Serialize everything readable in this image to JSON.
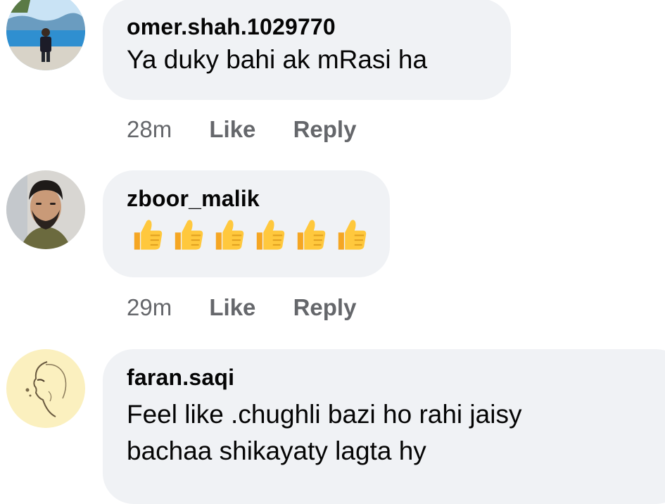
{
  "comments": [
    {
      "author": "omer.shah.1029770",
      "text": "Ya duky bahi ak mRasi ha",
      "time": "28m",
      "like_label": "Like",
      "reply_label": "Reply",
      "avatar": "profile-photo"
    },
    {
      "author": "zboor_malik",
      "text": "",
      "emoji": [
        "thumbs-up-icon",
        "thumbs-up-icon",
        "thumbs-up-icon",
        "thumbs-up-icon",
        "thumbs-up-icon",
        "thumbs-up-icon"
      ],
      "time": "29m",
      "like_label": "Like",
      "reply_label": "Reply",
      "avatar": "profile-photo"
    },
    {
      "author": "faran.saqi",
      "text_line1": "Feel like .chughli bazi ho rahi jaisy",
      "text_line2": "bachaa shikayaty lagta hy",
      "avatar": "profile-sketch"
    }
  ],
  "colors": {
    "bubble_bg": "#f0f2f5",
    "meta_text": "#65676b",
    "body_text": "#050505",
    "emoji_yellow": "#ffc83d"
  }
}
